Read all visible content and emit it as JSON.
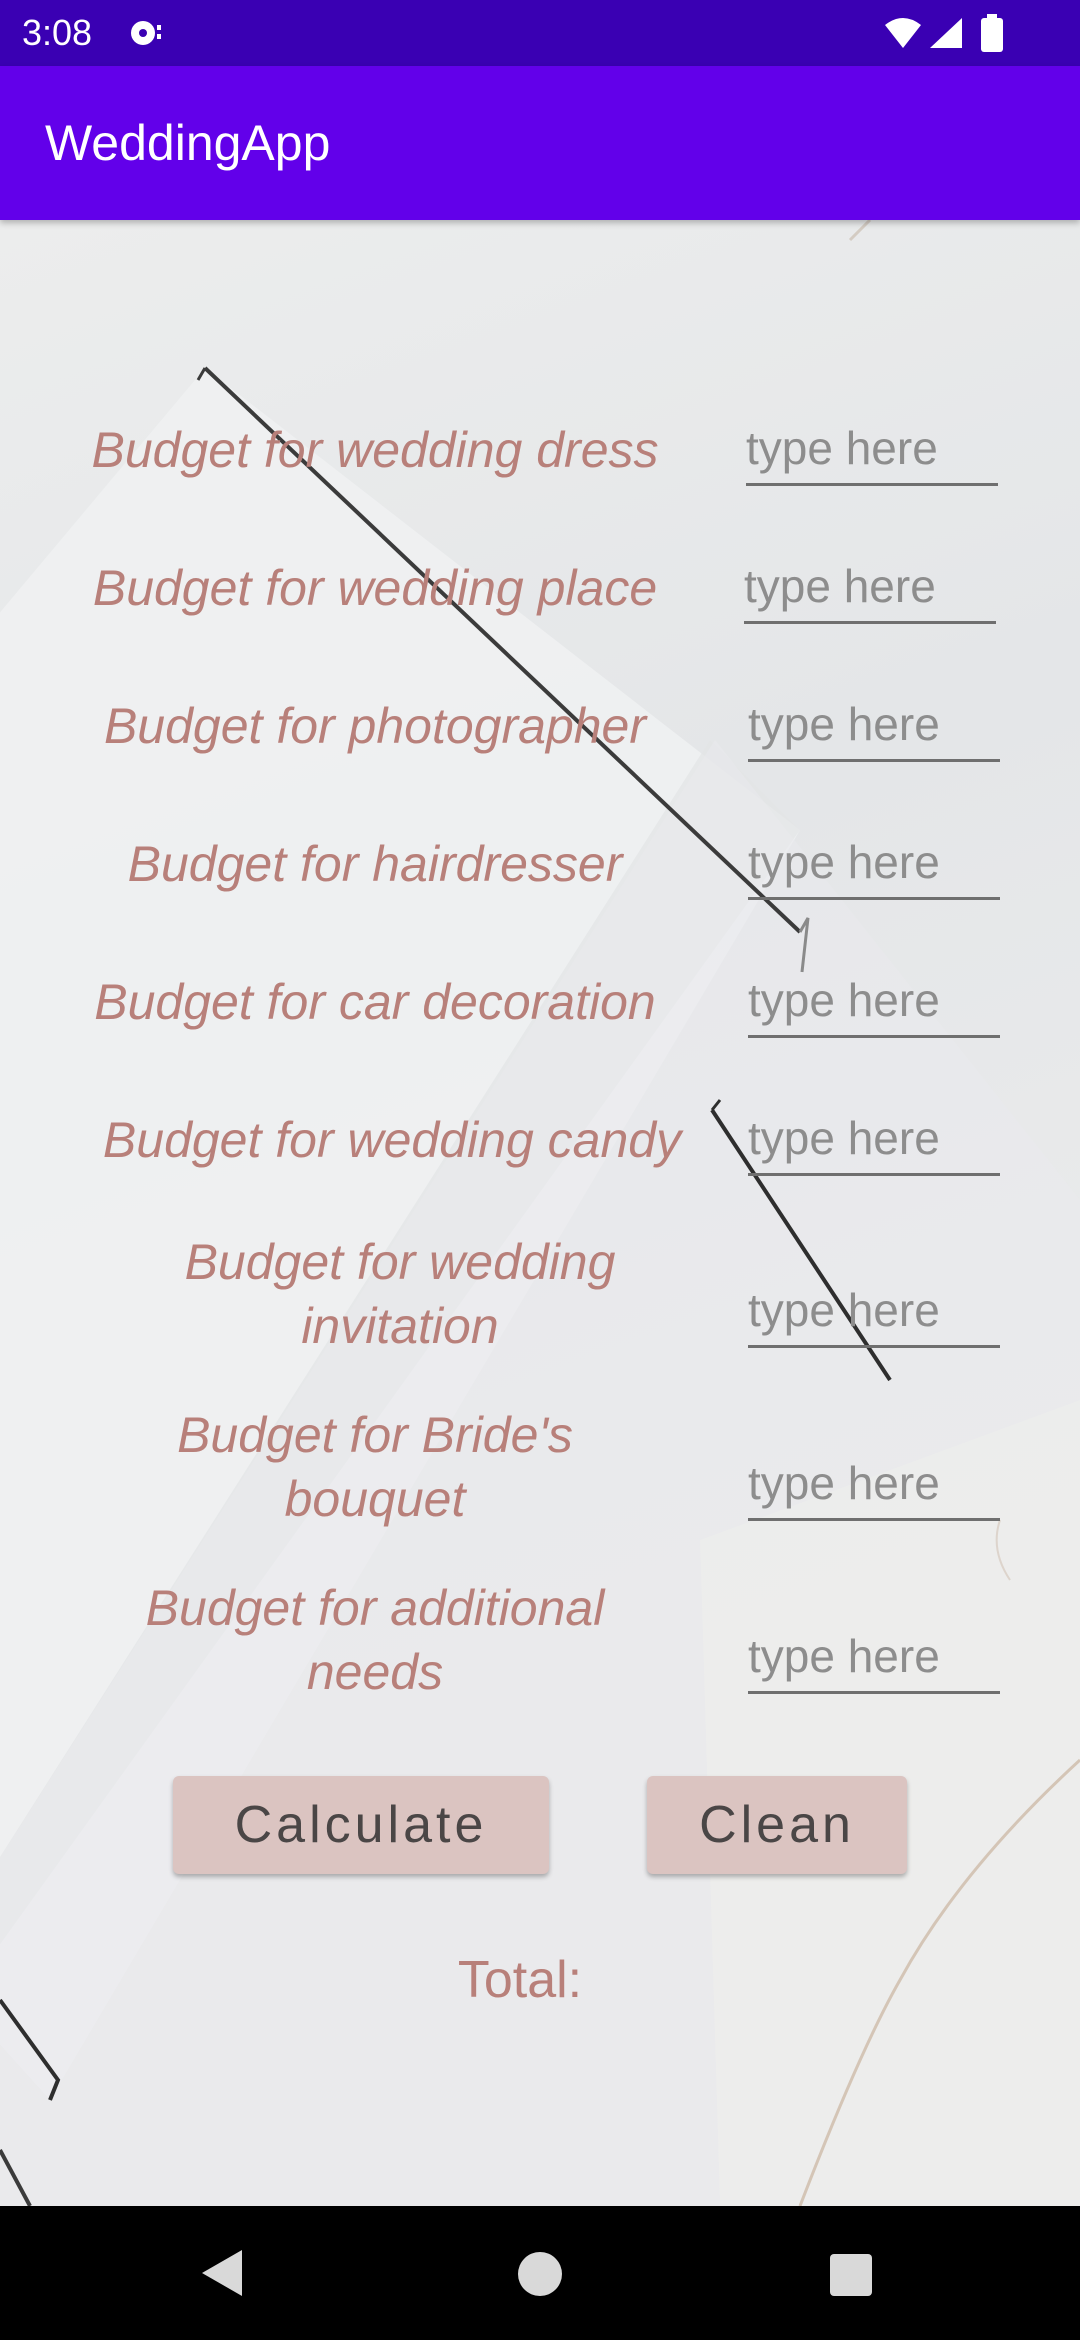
{
  "status_bar": {
    "time": "3:08"
  },
  "app_bar": {
    "title": "WeddingApp"
  },
  "form": {
    "rows": [
      {
        "label": "Budget for wedding dress",
        "placeholder": "type here",
        "value": ""
      },
      {
        "label": "Budget for wedding place",
        "placeholder": "type here",
        "value": ""
      },
      {
        "label": "Budget for photographer",
        "placeholder": "type here",
        "value": ""
      },
      {
        "label": "Budget for hairdresser",
        "placeholder": "type here",
        "value": ""
      },
      {
        "label": "Budget for car decoration",
        "placeholder": "type here",
        "value": ""
      },
      {
        "label": "Budget for wedding candy",
        "placeholder": "type here",
        "value": ""
      },
      {
        "label": "Budget for wedding invitation",
        "placeholder": "type here",
        "value": ""
      },
      {
        "label": "Budget for Bride's bouquet",
        "placeholder": "type here",
        "value": ""
      },
      {
        "label": "Budget for additional needs",
        "placeholder": "type here",
        "value": ""
      }
    ]
  },
  "actions": {
    "calculate_label": "Calculate",
    "clean_label": "Clean"
  },
  "result": {
    "total_label": "Total:"
  },
  "colors": {
    "status_bar": "#3a00b3",
    "app_bar": "#6200ea",
    "label_text": "#b8807a",
    "button_bg": "#dbc4c1"
  }
}
